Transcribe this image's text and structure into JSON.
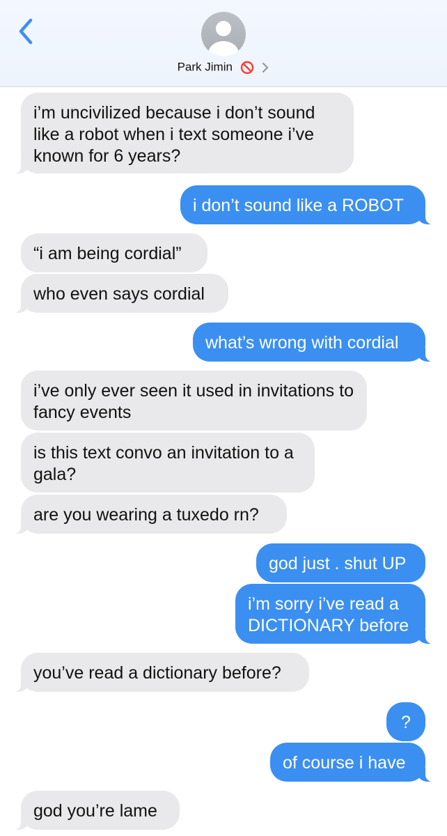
{
  "header": {
    "contact_name": "Park Jimin",
    "icons": {
      "back": "chevron-left-icon",
      "avatar": "person-silhouette-icon",
      "blocked": "no-entry-icon",
      "details": "chevron-right-icon"
    },
    "colors": {
      "accent": "#3b8ff1",
      "blocked": "#ff3b30"
    }
  },
  "messages": [
    {
      "from": "them",
      "text": "i’m uncivilized because i don’t sound like a robot when i text someone i’ve known for 6 years?"
    },
    {
      "from": "me",
      "text": "i don’t sound like a ROBOT"
    },
    {
      "from": "them",
      "text": "“i am being cordial”"
    },
    {
      "from": "them",
      "text": "who even says cordial"
    },
    {
      "from": "me",
      "text": "what’s wrong with cordial"
    },
    {
      "from": "them",
      "text": "i’ve only ever seen it used in invitations to fancy events"
    },
    {
      "from": "them",
      "text": "is this text convo an invitation to a gala?"
    },
    {
      "from": "them",
      "text": "are you wearing a tuxedo rn?"
    },
    {
      "from": "me",
      "text": "god just . shut UP"
    },
    {
      "from": "me",
      "text": "i’m sorry i’ve read a DICTIONARY before"
    },
    {
      "from": "them",
      "text": "you’ve read a dictionary before?"
    },
    {
      "from": "me",
      "text": "?"
    },
    {
      "from": "me",
      "text": "of course i have"
    },
    {
      "from": "them",
      "text": "god you’re lame"
    }
  ],
  "colors": {
    "incoming_bubble": "#e9e9eb",
    "outgoing_bubble": "#3b8ff1",
    "incoming_text": "#111111",
    "outgoing_text": "#ffffff"
  }
}
